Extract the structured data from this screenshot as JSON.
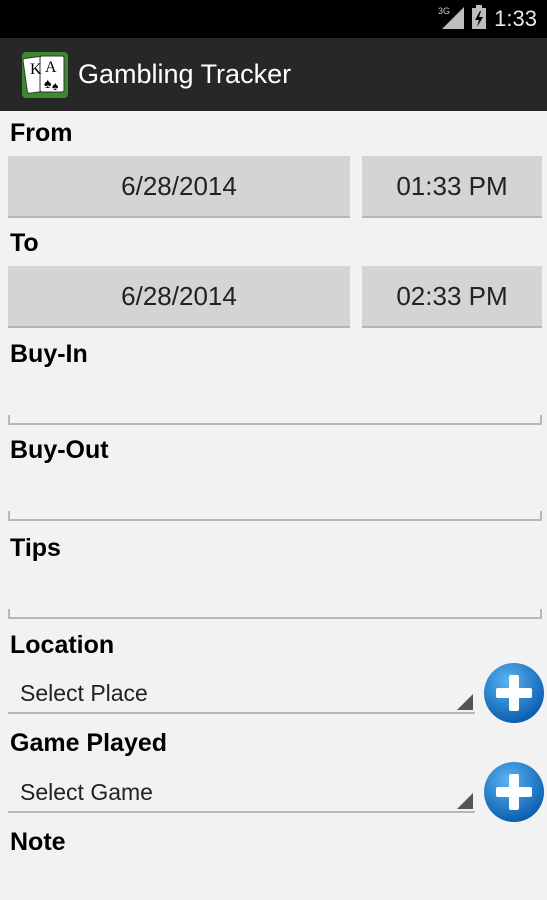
{
  "status_bar": {
    "time": "1:33",
    "network": "3G"
  },
  "action_bar": {
    "title": "Gambling Tracker",
    "app_icon": "playing-cards-icon"
  },
  "form": {
    "from_label": "From",
    "from_date": "6/28/2014",
    "from_time": "01:33 PM",
    "to_label": "To",
    "to_date": "6/28/2014",
    "to_time": "02:33 PM",
    "buyin_label": "Buy-In",
    "buyout_label": "Buy-Out",
    "tips_label": "Tips",
    "location_label": "Location",
    "location_value": "Select Place",
    "game_label": "Game Played",
    "game_value": "Select Game",
    "note_label": "Note"
  },
  "colors": {
    "accent_blue": "#1a7fd0",
    "action_bar": "#272727"
  }
}
